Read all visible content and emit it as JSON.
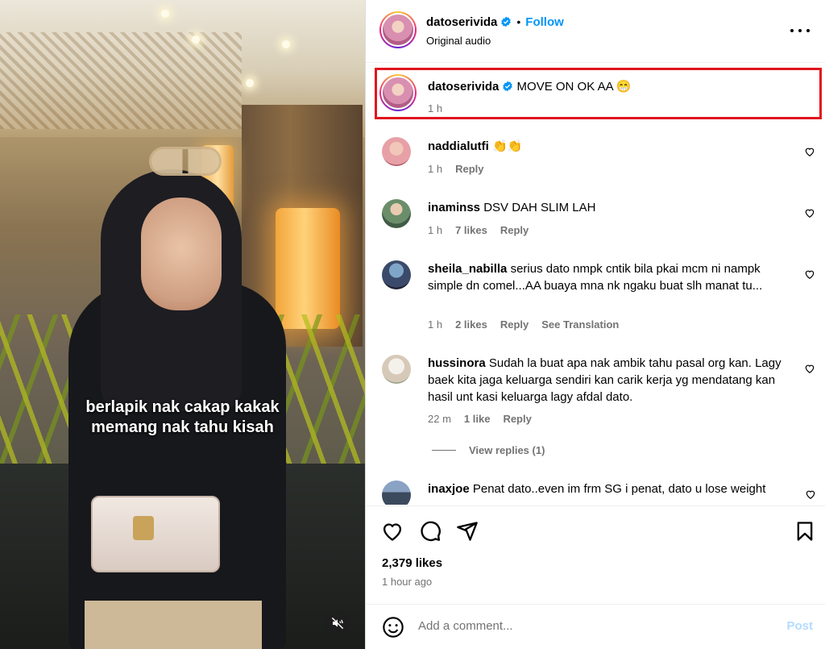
{
  "video": {
    "caption_line1": "berlapik nak cakap kakak",
    "caption_line2": "memang nak tahu kisah",
    "mute_icon": "speaker-muted-icon"
  },
  "header": {
    "username": "datoserivida",
    "verified": true,
    "separator": "•",
    "follow_label": "Follow",
    "audio_label": "Original audio",
    "more_icon": "more-options-icon"
  },
  "post_caption": {
    "username": "datoserivida",
    "text": "MOVE ON OK AA 😁",
    "time": "1 h"
  },
  "comments": [
    {
      "username": "naddialutfi",
      "text": "👏👏",
      "time": "1 h",
      "likes": "",
      "reply": "Reply",
      "extra": ""
    },
    {
      "username": "inaminss",
      "text": "DSV DAH SLIM LAH",
      "time": "1 h",
      "likes": "7 likes",
      "reply": "Reply",
      "extra": ""
    },
    {
      "username": "sheila_nabilla",
      "text": "serius dato nmpk cntik bila pkai mcm ni nampk simple dn comel...AA buaya mna nk ngaku buat slh manat tu...",
      "time": "1 h",
      "likes": "2 likes",
      "reply": "Reply",
      "extra": "See Translation"
    },
    {
      "username": "hussinora",
      "text": "Sudah la buat apa nak ambik tahu pasal org kan. Lagy baek kita jaga keluarga sendiri kan carik kerja yg mendatang kan hasil unt kasi keluarga lagy afdal dato.",
      "time": "22 m",
      "likes": "1 like",
      "reply": "Reply",
      "extra": ""
    },
    {
      "username": "inaxjoe",
      "text": "Penat dato..even im frm SG i penat, dato u lose weight",
      "time": "",
      "likes": "",
      "reply": "",
      "extra": ""
    }
  ],
  "view_replies": "View replies (1)",
  "actions": {
    "like_icon": "heart-icon",
    "comment_icon": "comment-bubble-icon",
    "share_icon": "send-paper-plane-icon",
    "save_icon": "bookmark-icon"
  },
  "likes_count": "2,379 likes",
  "posted_time": "1 hour ago",
  "add_comment": {
    "emoji_icon": "emoji-smile-icon",
    "placeholder": "Add a comment...",
    "post_label": "Post"
  },
  "colors": {
    "link_blue": "#0095f6",
    "secondary_text": "#737373",
    "highlight_box": "#e0141e",
    "post_disabled": "#b3dbff"
  }
}
